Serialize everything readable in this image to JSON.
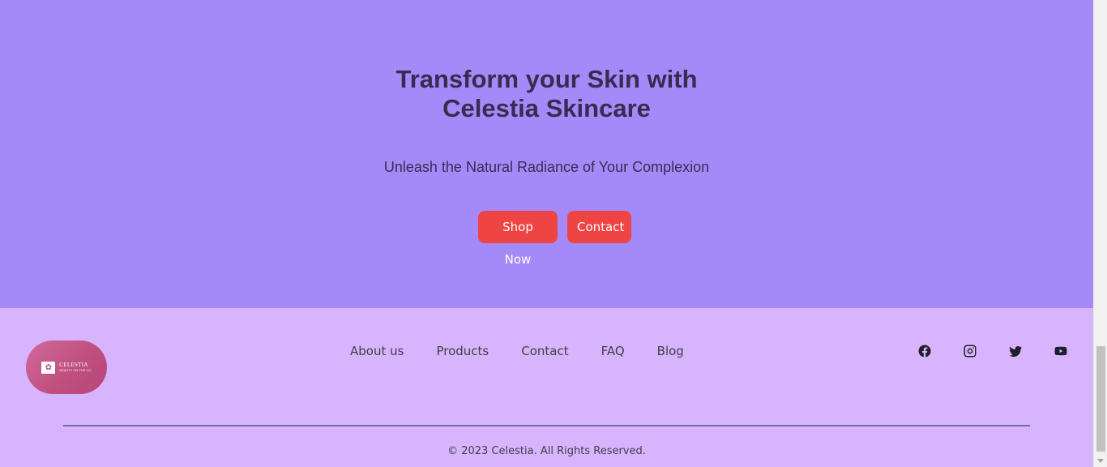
{
  "hero": {
    "title_line1": "Transform your Skin with",
    "title_line2": "Celestia Skincare",
    "subtitle": "Unleash the Natural Radiance of Your Complexion",
    "shop_button": "Shop Now",
    "contact_button": "Contact"
  },
  "footer": {
    "logo": {
      "name": "CELESTIA",
      "tagline": "BEAUTY ON THE GO"
    },
    "nav": [
      "About us",
      "Products",
      "Contact",
      "FAQ",
      "Blog"
    ],
    "social": [
      "facebook-icon",
      "instagram-icon",
      "twitter-icon",
      "youtube-icon"
    ],
    "copyright": "© 2023 Celestia. All Rights Reserved."
  },
  "colors": {
    "hero_bg": "#a48af8",
    "footer_bg": "#d8b4fe",
    "button_bg": "#ef4444",
    "heading_text": "#3a2a52",
    "divider": "#687594"
  }
}
